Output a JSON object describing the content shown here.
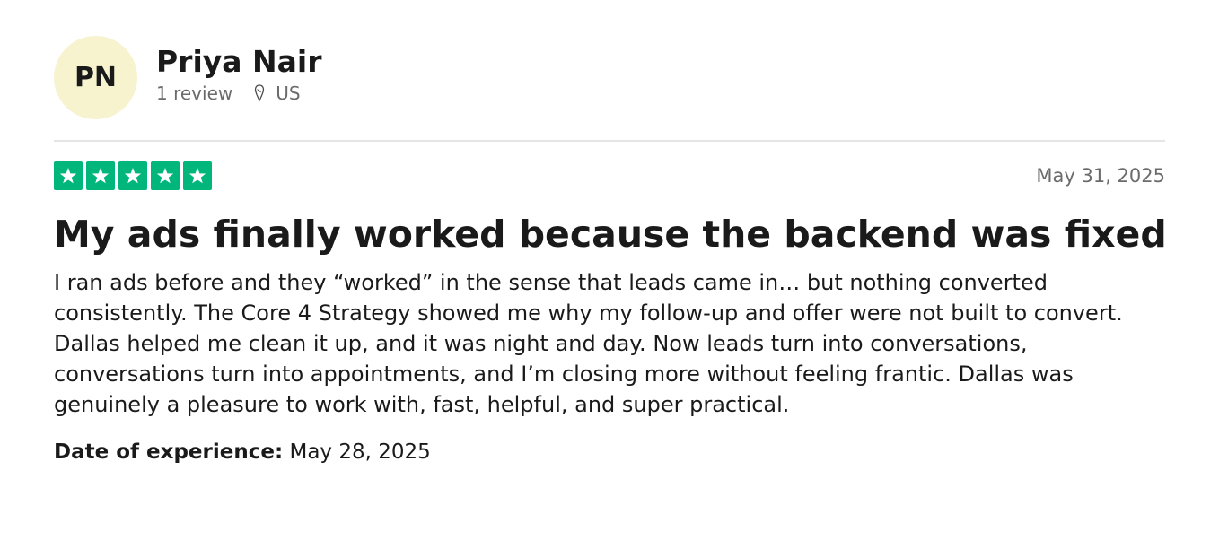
{
  "reviewer": {
    "initials": "PN",
    "name": "Priya Nair",
    "review_count": "1 review",
    "location": "US"
  },
  "review": {
    "rating": 5,
    "max_rating": 5,
    "date": "May 31, 2025",
    "title": "My ads finally worked because the backend was fixed",
    "body": "I ran ads before and they “worked” in the sense that leads came in… but nothing converted consistently. The Core 4 Strategy showed me why my follow-up and offer were not built to convert. Dallas helped me clean it up, and it was night and day. Now leads turn into conversations, conversations turn into appointments, and I’m closing more without feeling frantic. Dallas was genuinely a pleasure to work with, fast, helpful, and super practical.",
    "experience_label": "Date of experience:",
    "experience_date": "May 28, 2025"
  },
  "colors": {
    "avatar_bg": "#f7f3cf",
    "star_green": "#00b67a",
    "muted_text": "#6b6b6b"
  },
  "icons": {
    "location": "map-pin-icon",
    "star": "star-icon"
  }
}
